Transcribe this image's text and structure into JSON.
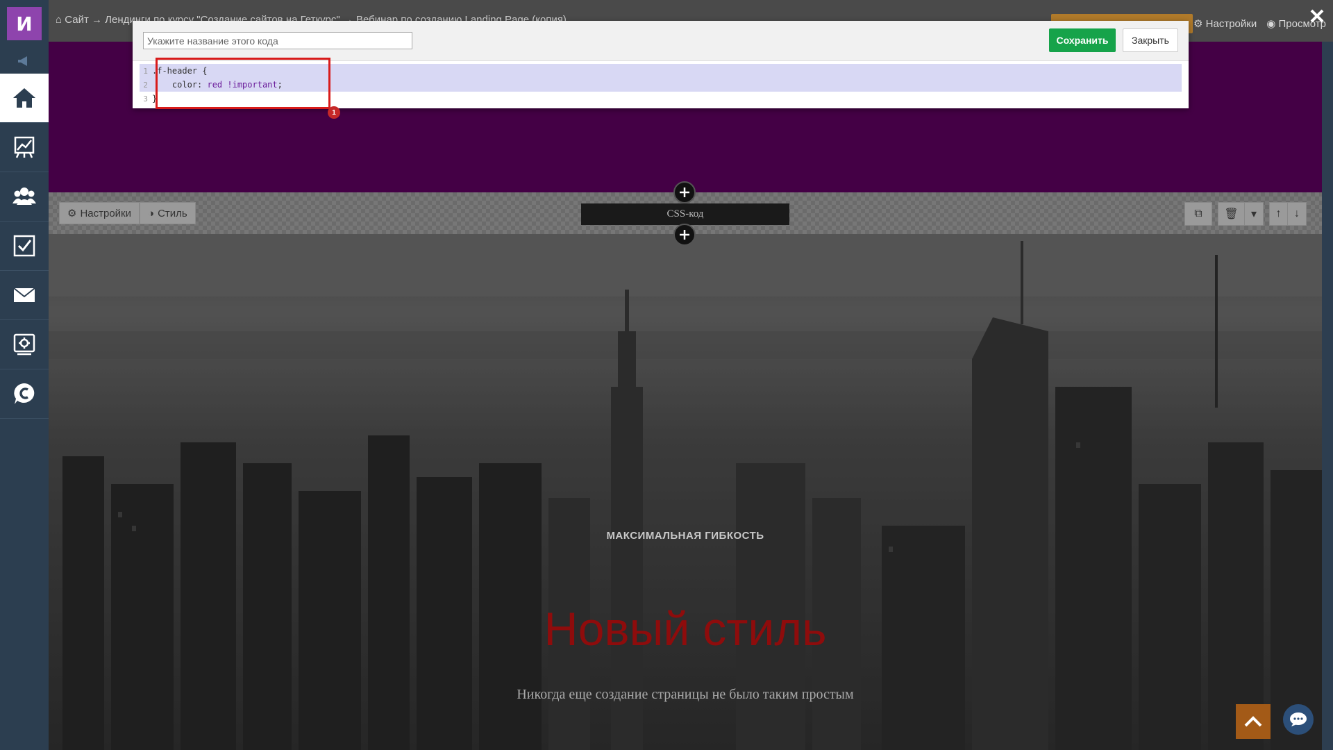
{
  "sidebar": {
    "avatar_letter": "И",
    "items": [
      "home-icon",
      "analytics-icon",
      "users-icon",
      "tasks-icon",
      "mail-icon",
      "settings-icon",
      "chat-c-icon"
    ]
  },
  "topbar": {
    "breadcrumb": "Сайт → Лендинги по курсу \"Создание сайтов на Геткурс\" → Вебинар по созданию Landing Page (копия)",
    "settings_label": "Настройки",
    "preview_label": "Просмотр"
  },
  "strip": {
    "settings_label": "Настройки",
    "style_label": "Стиль",
    "css_label": "CSS-код"
  },
  "modal": {
    "name_placeholder": "Укажите название этого кода",
    "save_label": "Сохранить",
    "close_label": "Закрыть",
    "code_lines": [
      {
        "num": "1",
        "text": ".f-header {"
      },
      {
        "num": "2",
        "indent": "    ",
        "prop": "color: ",
        "value": "red !important",
        "end": ";"
      },
      {
        "num": "3",
        "text": "}"
      }
    ],
    "annotation_number": "1"
  },
  "hero": {
    "eyebrow": "МАКСИМАЛЬНАЯ ГИБКОСТЬ",
    "title": "Новый стиль",
    "subtitle": "Никогда еще создание страницы не было таким простым"
  },
  "colors": {
    "sidebar_bg": "#2c3e50",
    "purple_section": "#440045",
    "save_green": "#16a34a",
    "highlight_red": "#d81b1b",
    "title_red": "#8e0c0c"
  }
}
